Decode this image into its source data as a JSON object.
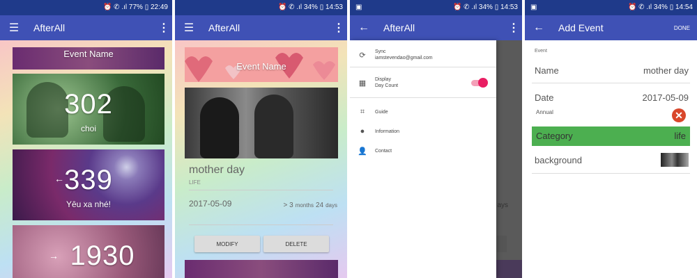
{
  "phone1": {
    "status": {
      "left": "",
      "right": "⏰ ✆ .ıl 77% ▯ 22:49"
    },
    "title": "AfterAll",
    "cards": [
      {
        "name": "Event Name"
      },
      {
        "count": "302",
        "label": "choi"
      },
      {
        "count": "339",
        "label": "Yêu xa nhé!"
      },
      {
        "count": "1930",
        "label": ""
      }
    ]
  },
  "phone2": {
    "status": {
      "right": "⏰ ✆ .ıl 34% ▯ 14:53"
    },
    "title": "AfterAll",
    "card_title": "Event Name",
    "event_name": "mother day",
    "event_category": "LIFE",
    "event_date": "2017-05-09",
    "duration_prefix": "> 3",
    "duration_months": "months",
    "duration_days_num": "24",
    "duration_days": "days",
    "modify_label": "MODIFY",
    "delete_label": "DELETE"
  },
  "phone3": {
    "status": {
      "right": "⏰ ✆ .ıl 34% ▯ 14:53"
    },
    "title": "AfterAll",
    "drawer": {
      "sync_label": "Sync",
      "sync_email": "iamstevendao@gmail.com",
      "display_label": "Display",
      "daycount_label": "Day Count",
      "guide_label": "Guide",
      "information_label": "Information",
      "contact_label": "Contact"
    },
    "behind_text": "ays"
  },
  "phone4": {
    "status": {
      "right": "⏰ ✆ .ıl 34% ▯ 14:54"
    },
    "title": "Add Event",
    "done_label": "DONE",
    "section_label": "Event",
    "name_label": "Name",
    "name_value": "mother day",
    "date_label": "Date",
    "date_value": "2017-05-09",
    "annual_label": "Annual",
    "category_label": "Category",
    "category_value": "life",
    "background_label": "background"
  },
  "colors": {
    "statusbar": "#1f3a8a",
    "appbar": "#3f51b5",
    "category_green": "#4caf50",
    "toggle_pink": "#e91e63",
    "cancel_red": "#d9472b"
  }
}
